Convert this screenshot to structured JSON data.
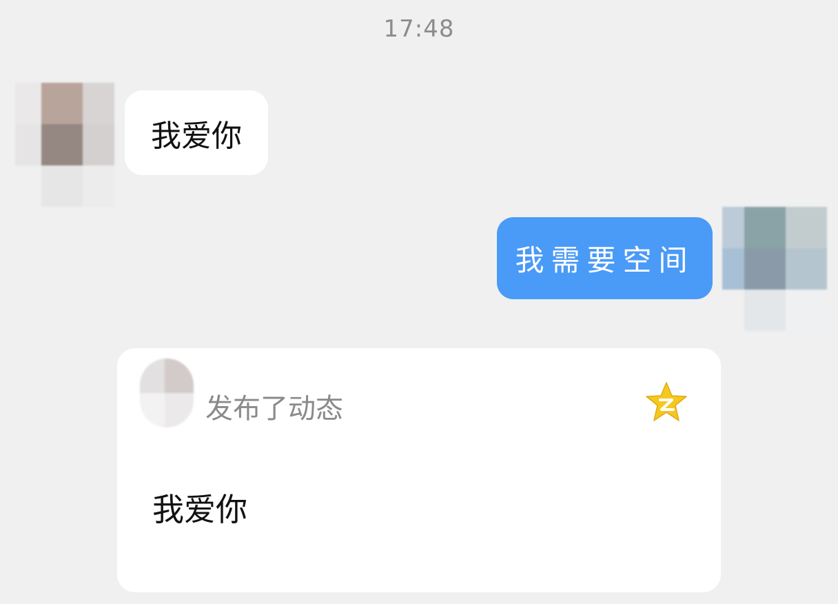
{
  "chat": {
    "timestamp": "17:48",
    "messages": [
      {
        "direction": "incoming",
        "text": "我爱你"
      },
      {
        "direction": "outgoing",
        "text": "我需要空间"
      }
    ],
    "share_card": {
      "header_text": "发布了动态",
      "content_text": "我爱你",
      "icon": "qzone-star-icon"
    }
  },
  "colors": {
    "background": "#f0f0f0",
    "outgoing_bubble": "#4a9af7",
    "incoming_bubble": "#ffffff",
    "qzone_star": "#f5c81f"
  }
}
